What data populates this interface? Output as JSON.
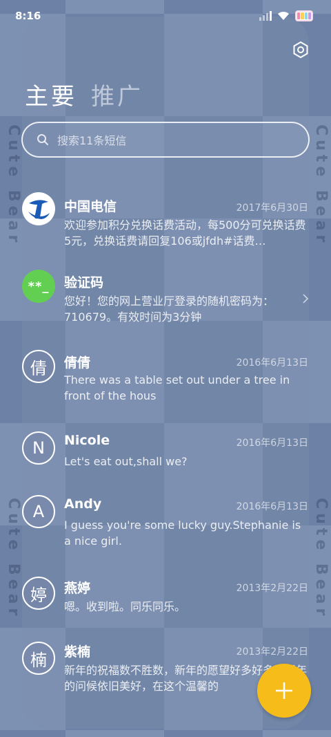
{
  "status_bar": {
    "time": "8:16",
    "battery_colors": [
      "#f28bb0",
      "#f9cf5e",
      "#8fd4f0",
      "#c59ae8"
    ]
  },
  "header": {
    "tabs": [
      {
        "label": "主要",
        "active": true
      },
      {
        "label": "推广",
        "active": false
      }
    ],
    "settings_icon": "gear-icon"
  },
  "search": {
    "placeholder": "搜索11条短信"
  },
  "wallpaper": {
    "side_text": "Cute Bear"
  },
  "conversations": [
    {
      "name": "中国电信",
      "date": "2017年6月30日",
      "preview": "欢迎参加积分兑换话费活动，每500分可兑换话费5元，兑换话费请回复106或jfdh#话费…",
      "avatar_type": "telecom-logo"
    },
    {
      "name": "验证码",
      "date": "",
      "preview": "您好！您的网上营业厅登录的随机密码为：710679。有效时间为3分钟",
      "avatar_type": "code",
      "avatar_text": "**_"
    },
    {
      "name": "倩倩",
      "date": "2016年6月13日",
      "preview": "There was a table set out under a tree in front of the hous",
      "avatar_type": "letter",
      "avatar_text": "倩"
    },
    {
      "name": "Nicole",
      "date": "2016年6月13日",
      "preview": "Let's eat out,shall we?",
      "avatar_type": "letter",
      "avatar_text": "N"
    },
    {
      "name": "Andy",
      "date": "2016年6月13日",
      "preview": "I guess you're some lucky guy.Stephanie is a nice girl.",
      "avatar_type": "letter",
      "avatar_text": "A"
    },
    {
      "name": "燕婷",
      "date": "2013年2月22日",
      "preview": "嗯。收到啦。同乐同乐。",
      "avatar_type": "letter",
      "avatar_text": "婷"
    },
    {
      "name": "紫楠",
      "date": "2013年2月22日",
      "preview": "新年的祝福数不胜数，新年的愿望好多好多，新年的问候依旧美好，在这个温馨的",
      "avatar_type": "letter",
      "avatar_text": "楠"
    }
  ],
  "fab": {
    "icon": "plus-icon",
    "color": "#f6bd1a"
  }
}
